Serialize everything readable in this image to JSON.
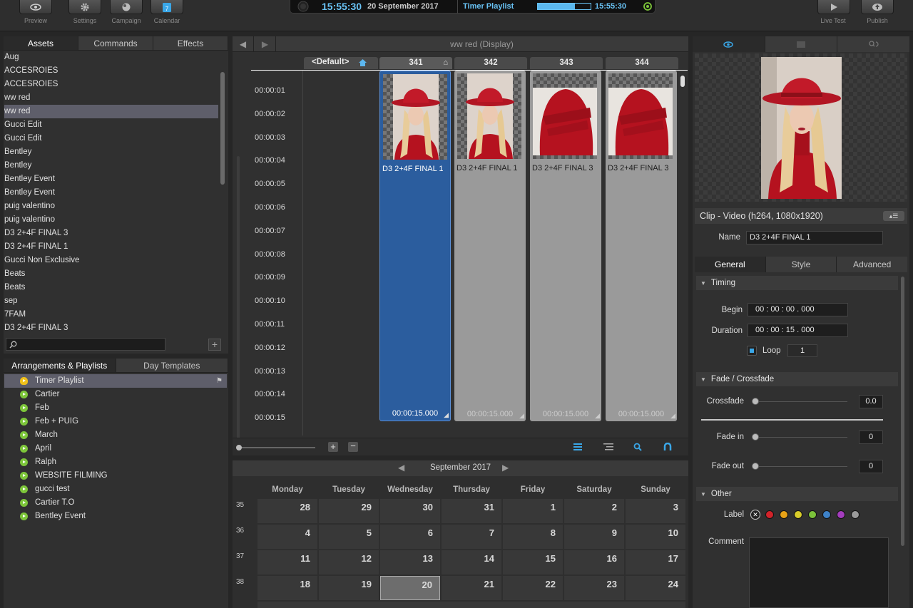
{
  "toolbar": {
    "preview": "Preview",
    "settings": "Settings",
    "campaign": "Campaign",
    "calendar": "Calendar",
    "live_test": "Live Test",
    "publish": "Publish"
  },
  "clock": {
    "time": "15:55:30",
    "date": "20 September 2017",
    "playlist": "Timer Playlist",
    "progress": 0.7,
    "end_time": "15:55:30"
  },
  "assets": {
    "tabs": [
      "Assets",
      "Commands",
      "Effects"
    ],
    "items": [
      {
        "label": "Aug",
        "type": "folder",
        "depth": 0,
        "expanded": true
      },
      {
        "label": "ACCESROIES",
        "type": "folder",
        "depth": 1
      },
      {
        "label": "ACCESROIES",
        "type": "display",
        "depth": 1
      },
      {
        "label": "ww red",
        "type": "folder",
        "depth": 1
      },
      {
        "label": "ww red",
        "type": "display",
        "depth": 1,
        "selected": true
      },
      {
        "label": "Gucci Edit",
        "type": "folder",
        "depth": 1
      },
      {
        "label": "Gucci Edit",
        "type": "display",
        "depth": 1
      },
      {
        "label": "Bentley",
        "type": "folder",
        "depth": 1
      },
      {
        "label": "Bentley",
        "type": "display",
        "depth": 1
      },
      {
        "label": "Bentley Event",
        "type": "folder",
        "depth": 1
      },
      {
        "label": "Bentley Event",
        "type": "display",
        "depth": 1
      },
      {
        "label": "puig valentino",
        "type": "folder",
        "depth": 1
      },
      {
        "label": "puig valentino",
        "type": "display",
        "depth": 1
      },
      {
        "label": "D3 2+4F  FINAL 3",
        "type": "film",
        "depth": 1
      },
      {
        "label": "D3 2+4F  FINAL 1",
        "type": "film",
        "depth": 1
      },
      {
        "label": "Gucci Non Exclusive",
        "type": "display",
        "depth": 1
      },
      {
        "label": "Beats",
        "type": "folder",
        "depth": 1
      },
      {
        "label": "Beats",
        "type": "display",
        "depth": 1
      },
      {
        "label": "sep",
        "type": "folder",
        "depth": 0,
        "expanded": true
      },
      {
        "label": "7FAM",
        "type": "folder",
        "depth": 1,
        "expanded": true
      },
      {
        "label": "D3 2+4F  FINAL 3",
        "type": "film",
        "depth": 2
      }
    ]
  },
  "playlists": {
    "tabs": [
      "Arrangements & Playlists",
      "Day Templates"
    ],
    "items": [
      "Timer Playlist",
      "Cartier",
      "Feb",
      "Feb + PUIG",
      "March",
      "April",
      "Ralph",
      "WEBSITE FILMING",
      "gucci test",
      "Cartier T.O",
      "Bentley Event"
    ]
  },
  "timeline": {
    "title": "ww red (Display)",
    "default_label": "<Default>",
    "columns": [
      "341",
      "342",
      "343",
      "344"
    ],
    "times": [
      "00:00:01",
      "00:00:02",
      "00:00:03",
      "00:00:04",
      "00:00:05",
      "00:00:06",
      "00:00:07",
      "00:00:08",
      "00:00:09",
      "00:00:10",
      "00:00:11",
      "00:00:12",
      "00:00:13",
      "00:00:14",
      "00:00:15"
    ],
    "clips": [
      {
        "title": "D3 2+4F  FINAL 1",
        "duration": "00:00:15.000",
        "active": true,
        "thumb": "portrait"
      },
      {
        "title": "D3 2+4F  FINAL 1",
        "duration": "00:00:15.000",
        "active": false,
        "thumb": "portrait"
      },
      {
        "title": "D3 2+4F  FINAL 3",
        "duration": "00:00:15.000",
        "active": false,
        "thumb": "torso"
      },
      {
        "title": "D3 2+4F  FINAL 3",
        "duration": "00:00:15.000",
        "active": false,
        "thumb": "torso"
      }
    ]
  },
  "calendar": {
    "month": "September 2017",
    "days": [
      "Monday",
      "Tuesday",
      "Wednesday",
      "Thursday",
      "Friday",
      "Saturday",
      "Sunday"
    ],
    "weeks": [
      {
        "num": "35",
        "dates": [
          "28",
          "29",
          "30",
          "31",
          "1",
          "2",
          "3"
        ]
      },
      {
        "num": "36",
        "dates": [
          "4",
          "5",
          "6",
          "7",
          "8",
          "9",
          "10"
        ]
      },
      {
        "num": "37",
        "dates": [
          "11",
          "12",
          "13",
          "14",
          "15",
          "16",
          "17"
        ]
      },
      {
        "num": "38",
        "dates": [
          "18",
          "19",
          "20",
          "21",
          "22",
          "23",
          "24"
        ]
      }
    ],
    "today": "20"
  },
  "inspector": {
    "clip_header": "Clip - Video (h264, 1080x1920)",
    "name_label": "Name",
    "name_value": "D3 2+4F  FINAL 1",
    "tabs": [
      "General",
      "Style",
      "Advanced"
    ],
    "timing": "Timing",
    "begin_label": "Begin",
    "begin_value": "00 : 00 : 00 . 000",
    "duration_label": "Duration",
    "duration_value": "00 : 00 : 15 . 000",
    "loop_label": "Loop",
    "loop_value": "1",
    "fade": "Fade / Crossfade",
    "crossfade_label": "Crossfade",
    "crossfade_value": "0.0",
    "fadein_label": "Fade in",
    "fadein_value": "0",
    "fadeout_label": "Fade out",
    "fadeout_value": "0",
    "other": "Other",
    "label_label": "Label",
    "comment_label": "Comment",
    "label_colors": [
      "#d2232a",
      "#e8a317",
      "#d8cc2a",
      "#7cc23a",
      "#3e82c8",
      "#a43dbe",
      "#9a9a9a"
    ]
  }
}
